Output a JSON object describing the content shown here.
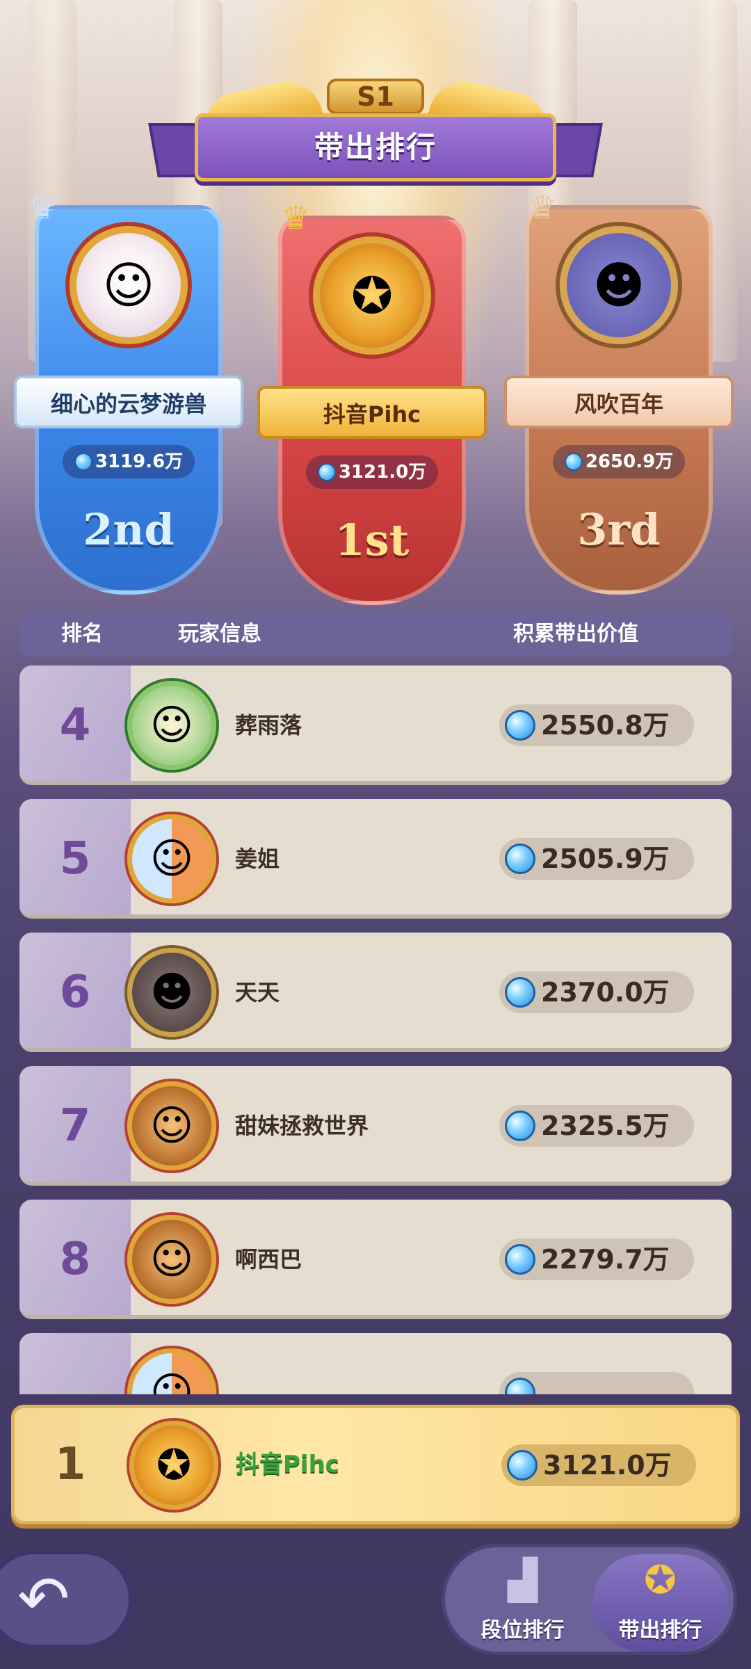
{
  "header": {
    "season": "S1",
    "title": "带出排行"
  },
  "podium": [
    {
      "place_label": "2nd",
      "name": "细心的云梦游兽",
      "value": "3119.6万"
    },
    {
      "place_label": "1st",
      "name": "抖音Pihc",
      "value": "3121.0万"
    },
    {
      "place_label": "3rd",
      "name": "风吹百年",
      "value": "2650.9万"
    }
  ],
  "table": {
    "col_rank": "排名",
    "col_player": "玩家信息",
    "col_value": "积累带出价值",
    "rows": [
      {
        "rank": "4",
        "name": "葬雨落",
        "value": "2550.8万"
      },
      {
        "rank": "5",
        "name": "姜姐",
        "value": "2505.9万"
      },
      {
        "rank": "6",
        "name": "天天",
        "value": "2370.0万"
      },
      {
        "rank": "7",
        "name": "甜妹拯救世界",
        "value": "2325.5万"
      },
      {
        "rank": "8",
        "name": "啊西巴",
        "value": "2279.7万"
      }
    ]
  },
  "self_row": {
    "rank": "1",
    "name": "抖音Pihc",
    "value": "3121.0万"
  },
  "bottom_tabs": [
    {
      "label": "段位排行",
      "icon": "podium-icon"
    },
    {
      "label": "带出排行",
      "icon": "medal-icon",
      "selected": true
    }
  ],
  "back_icon": "back-arrow-icon"
}
